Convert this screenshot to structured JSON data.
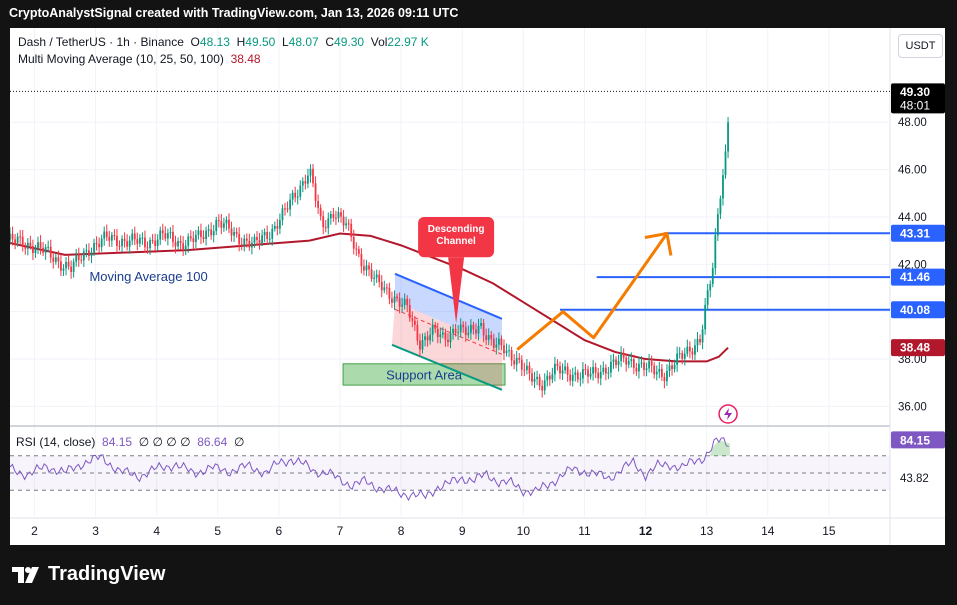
{
  "header": "CryptoAnalystSignal created with TradingView.com, Jan 13, 2026 09:11 UTC",
  "brand": "TradingView",
  "symbol_legend": {
    "title": "Dash / TetherUS · 1h · Binance",
    "o_label": "O",
    "o": "48.13",
    "h_label": "H",
    "h": "49.50",
    "l_label": "L",
    "l": "48.07",
    "c_label": "C",
    "c": "49.30",
    "vol_label": "Vol",
    "vol": "22.97 K"
  },
  "ma_legend": {
    "label": "Multi Moving Average (10, 25, 50, 100)",
    "value": "38.48"
  },
  "rsi_legend": {
    "label": "RSI (14, close)",
    "v1": "84.15",
    "zeros": "∅ ∅ ∅ ∅",
    "v2": "86.64",
    "tail": "∅"
  },
  "currency_button": "USDT",
  "annotations": {
    "ma_label": "Moving Average 100",
    "support_label": "Support Area",
    "callout_line1": "Descending",
    "callout_line2": "Channel"
  },
  "colors": {
    "up": "#089981",
    "down": "#f23645",
    "ma": "#b2182b",
    "level_line": "#2962ff",
    "projection": "#f57c00",
    "rsi": "#7e57c2",
    "support_fill": "#66bb6a",
    "callout": "#f23645"
  },
  "chart_data": {
    "type": "line",
    "subtype": "candlestick",
    "price_axis": {
      "ylim": [
        35.3,
        50.5
      ],
      "ticks": [
        "48.00",
        "46.00",
        "44.00",
        "42.00",
        "40.00",
        "38.00",
        "36.00"
      ],
      "tick_values": [
        48,
        46,
        44,
        42,
        40,
        38,
        36
      ]
    },
    "time_axis": {
      "ticks": [
        "2",
        "3",
        "4",
        "5",
        "6",
        "7",
        "8",
        "9",
        "10",
        "11",
        "12",
        "13",
        "14",
        "15"
      ],
      "bold_ticks": [
        "12"
      ],
      "day_range": [
        1.6,
        16.0
      ]
    },
    "price_labels": [
      {
        "text": "49.30",
        "sub": "48:01",
        "value": 49.3,
        "style": "last"
      },
      {
        "text": "43.31",
        "value": 43.31,
        "style": "blue"
      },
      {
        "text": "41.46",
        "value": 41.46,
        "style": "blue"
      },
      {
        "text": "40.08",
        "value": 40.08,
        "style": "blue"
      },
      {
        "text": "38.48",
        "value": 38.48,
        "style": "red"
      }
    ],
    "horizontal_levels": [
      {
        "value": 43.31,
        "from_day": 12.3
      },
      {
        "value": 41.46,
        "from_day": 11.2
      },
      {
        "value": 40.08,
        "from_day": 10.6
      }
    ],
    "close_series": {
      "day": [
        1.6,
        2.0,
        2.3,
        2.6,
        2.9,
        3.2,
        3.5,
        3.8,
        4.1,
        4.4,
        4.7,
        5.0,
        5.3,
        5.6,
        5.9,
        6.1,
        6.3,
        6.5,
        6.7,
        6.9,
        7.1,
        7.3,
        7.6,
        7.9,
        8.1,
        8.3,
        8.5,
        8.7,
        8.9,
        9.1,
        9.3,
        9.5,
        9.7,
        9.9,
        10.1,
        10.3,
        10.5,
        10.8,
        11.1,
        11.4,
        11.7,
        12.0,
        12.3,
        12.6,
        12.9,
        13.0,
        13.1,
        13.15,
        13.2,
        13.25,
        13.3,
        13.35,
        13.38
      ],
      "close": [
        43.0,
        42.8,
        42.3,
        41.8,
        42.7,
        43.1,
        43.0,
        42.9,
        43.2,
        42.9,
        43.1,
        43.8,
        43.2,
        42.8,
        43.5,
        44.2,
        45.1,
        46.0,
        43.5,
        44.3,
        43.6,
        42.4,
        41.2,
        40.6,
        40.1,
        38.7,
        39.2,
        38.8,
        39.4,
        39.0,
        39.5,
        38.6,
        38.4,
        38.0,
        37.2,
        37.0,
        37.5,
        37.4,
        37.3,
        37.7,
        38.0,
        37.6,
        37.4,
        38.1,
        38.9,
        40.4,
        41.8,
        43.2,
        44.6,
        45.6,
        46.4,
        48.2,
        49.3
      ]
    },
    "moving_average_100": {
      "day": [
        1.6,
        2.5,
        3.5,
        4.5,
        5.5,
        6.5,
        7.0,
        7.5,
        8.0,
        8.5,
        9.0,
        9.5,
        10.0,
        10.5,
        11.0,
        11.5,
        12.0,
        12.5,
        13.0,
        13.2,
        13.35
      ],
      "value": [
        42.9,
        42.4,
        42.5,
        42.6,
        42.8,
        43.0,
        43.3,
        43.2,
        42.8,
        42.3,
        41.8,
        41.2,
        40.4,
        39.6,
        38.8,
        38.3,
        38.0,
        37.9,
        37.9,
        38.1,
        38.48
      ]
    },
    "descending_channel": {
      "upper": [
        [
          7.9,
          41.6
        ],
        [
          9.65,
          39.7
        ]
      ],
      "lower": [
        [
          7.85,
          38.6
        ],
        [
          9.65,
          36.7
        ]
      ]
    },
    "support_area": {
      "from_day": 7.05,
      "to_day": 9.7,
      "low": 36.9,
      "high": 37.8
    },
    "projection_path": [
      [
        9.9,
        38.4
      ],
      [
        10.65,
        40.0
      ],
      [
        11.15,
        38.9
      ],
      [
        12.35,
        43.3
      ]
    ],
    "rsi": {
      "label": "RSI (14, close)",
      "ticks": [
        "84.15",
        "43.82"
      ],
      "levels": [
        70,
        50,
        30
      ],
      "day": [
        1.6,
        1.9,
        2.2,
        2.5,
        2.8,
        3.1,
        3.4,
        3.7,
        4.0,
        4.3,
        4.6,
        4.9,
        5.2,
        5.5,
        5.8,
        6.0,
        6.2,
        6.4,
        6.6,
        6.8,
        7.0,
        7.2,
        7.4,
        7.6,
        7.8,
        8.0,
        8.2,
        8.4,
        8.6,
        8.8,
        9.0,
        9.2,
        9.4,
        9.6,
        9.8,
        10.0,
        10.2,
        10.4,
        10.6,
        10.8,
        11.0,
        11.2,
        11.4,
        11.6,
        11.8,
        12.0,
        12.2,
        12.4,
        12.6,
        12.8,
        12.95,
        13.05,
        13.15,
        13.25,
        13.38
      ],
      "value": [
        55,
        48,
        58,
        50,
        62,
        68,
        52,
        46,
        55,
        60,
        50,
        56,
        52,
        58,
        50,
        62,
        66,
        60,
        52,
        50,
        42,
        36,
        40,
        34,
        30,
        26,
        25,
        22,
        34,
        38,
        44,
        42,
        48,
        40,
        38,
        30,
        28,
        36,
        46,
        54,
        52,
        48,
        44,
        54,
        62,
        48,
        58,
        60,
        56,
        64,
        68,
        76,
        86,
        88,
        84
      ]
    }
  }
}
